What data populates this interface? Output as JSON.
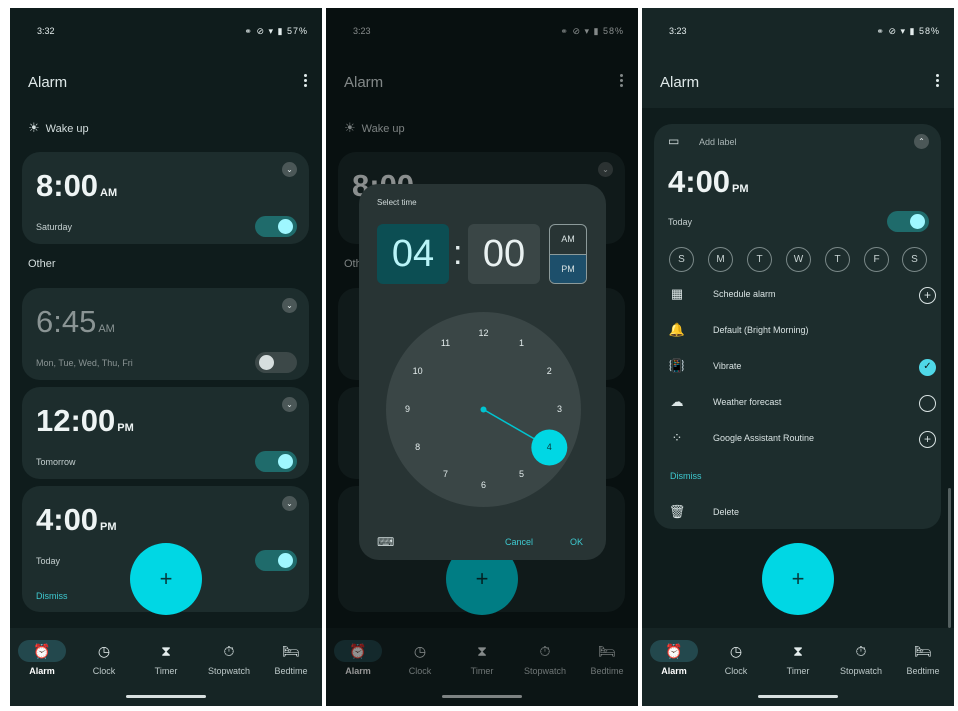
{
  "panel1": {
    "status": {
      "time": "3:32",
      "icons": "⚭ ⊘ ▾ ▮ 57%"
    },
    "title": "Alarm",
    "wake_section": "Wake up",
    "other_section": "Other",
    "alarms": [
      {
        "time": "8:00",
        "ampm": "AM",
        "days": "Saturday",
        "enabled": true
      },
      {
        "time": "6:45",
        "ampm": "AM",
        "days": "Mon, Tue, Wed, Thu, Fri",
        "enabled": false
      },
      {
        "time": "12:00",
        "ampm": "PM",
        "days": "Tomorrow",
        "enabled": true
      },
      {
        "time": "4:00",
        "ampm": "PM",
        "days": "Today",
        "enabled": true,
        "dismiss": "Dismiss"
      }
    ]
  },
  "panel2": {
    "status": {
      "time": "3:23",
      "icons": "⚭ ⊘ ▾ ▮ 58%"
    },
    "title": "Alarm",
    "wake_section": "Wake up",
    "bg_time": "8:00",
    "bg_other": "Oth",
    "dialog": {
      "title": "Select time",
      "hour": "04",
      "colon": ":",
      "minute": "00",
      "am": "AM",
      "pm": "PM",
      "selected_period": "PM",
      "dial_numbers": [
        "12",
        "1",
        "2",
        "3",
        "4",
        "5",
        "6",
        "7",
        "8",
        "9",
        "10",
        "11"
      ],
      "selected_hour": "4",
      "cancel": "Cancel",
      "ok": "OK"
    }
  },
  "panel3": {
    "status": {
      "time": "3:23",
      "icons": "⚭ ⊘ ▾ ▮ 58%"
    },
    "title": "Alarm",
    "add_label": "Add label",
    "time": "4:00",
    "ampm": "PM",
    "day_text": "Today",
    "days": [
      "S",
      "M",
      "T",
      "W",
      "T",
      "F",
      "S"
    ],
    "options": [
      {
        "label": "Schedule alarm",
        "icon": "calendar-icon",
        "control": "add"
      },
      {
        "label": "Default (Bright Morning)",
        "icon": "bell-icon",
        "control": "none"
      },
      {
        "label": "Vibrate",
        "icon": "vibrate-icon",
        "control": "checked"
      },
      {
        "label": "Weather forecast",
        "icon": "weather-icon",
        "control": "unchecked"
      },
      {
        "label": "Google Assistant Routine",
        "icon": "assistant-icon",
        "control": "add"
      }
    ],
    "dismiss": "Dismiss",
    "delete": "Delete"
  },
  "nav": [
    {
      "label": "Alarm",
      "icon": "alarm-icon"
    },
    {
      "label": "Clock",
      "icon": "clock-icon"
    },
    {
      "label": "Timer",
      "icon": "hourglass-icon"
    },
    {
      "label": "Stopwatch",
      "icon": "stopwatch-icon"
    },
    {
      "label": "Bedtime",
      "icon": "bed-icon"
    }
  ],
  "fab_symbol": "+",
  "colors": {
    "background": "#0f1c1c",
    "card": "#1d2d2d",
    "accent": "#00d7e4",
    "toggle_on": "#1f6b6b"
  }
}
